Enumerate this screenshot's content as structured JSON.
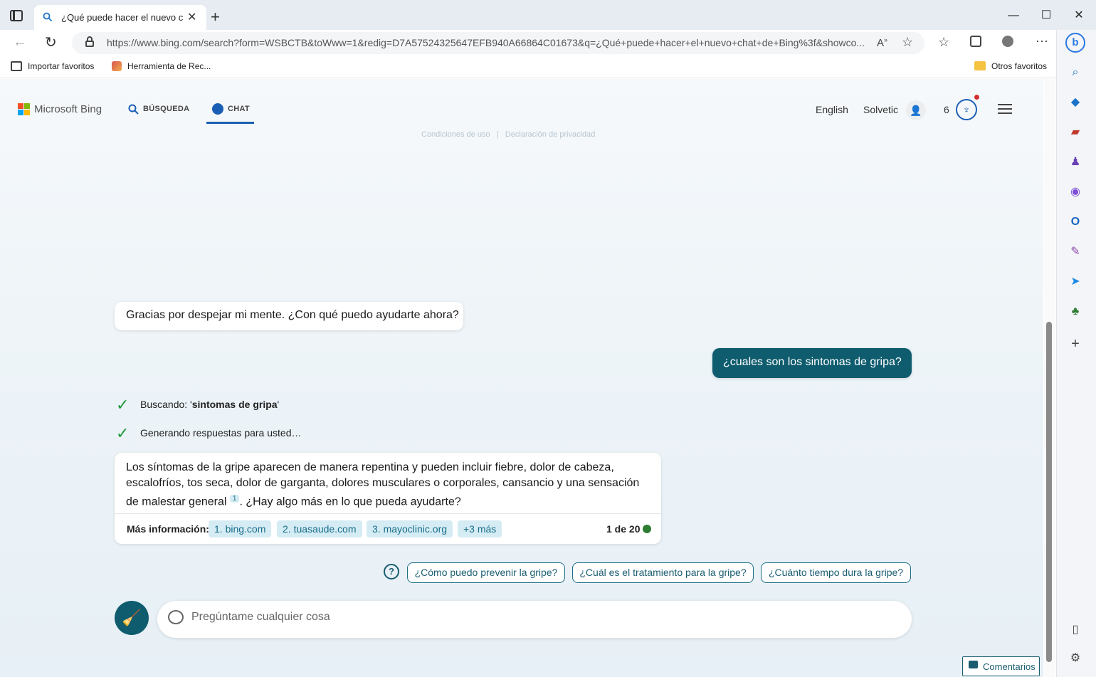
{
  "browser": {
    "tab_title": "¿Qué puede hacer el nuevo chat",
    "url": "https://www.bing.com/search?form=WSBCTB&toWww=1&redig=D7A57524325647EFB940A66864C01673&q=¿Qué+puede+hacer+el+nuevo+chat+de+Bing%3f&showco...",
    "favorites": [
      "Importar favoritos",
      "Herramienta de Rec..."
    ],
    "other_favorites": "Otros favoritos"
  },
  "header": {
    "logo": "Microsoft Bing",
    "nav_search": "BÚSQUEDA",
    "nav_chat": "CHAT",
    "language": "English",
    "user": "Solvetic",
    "points": "6",
    "faded_links": "Condiciones de uso   |   Declaración de privacidad"
  },
  "chat": {
    "bot_greeting": "Gracias por despejar mi mente. ¿Con qué puedo ayudarte ahora?",
    "user_message": "¿cuales son los sintomas de gripa?",
    "status_searching_prefix": "Buscando: '",
    "status_searching_term": "sintomas de gripa",
    "status_searching_suffix": "'",
    "status_generating": "Generando respuestas para usted…",
    "answer_part1": "Los síntomas de la gripe aparecen de manera repentina y pueden incluir fiebre, dolor de cabeza, escalofríos, tos seca, dolor de garganta, dolores musculares o corporales, cansancio y una sensación de malestar general",
    "answer_citation": "1",
    "answer_part2": ". ¿Hay algo más en lo que pueda ayudarte?",
    "more_info_label": "Más información:",
    "sources": [
      "1. bing.com",
      "2. tuasaude.com",
      "3. mayoclinic.org",
      "+3 más"
    ],
    "turn_counter": "1 de 20",
    "suggestions": [
      "¿Cómo puedo prevenir la gripe?",
      "¿Cuál es el tratamiento para la gripe?",
      "¿Cuánto tiempo dura la gripe?"
    ],
    "input_placeholder": "Pregúntame cualquier cosa"
  },
  "feedback": "Comentarios",
  "colors": {
    "accent_teal": "#0e5c6e",
    "check_green": "#1e9a3c",
    "chip_bg": "#d5ecf4"
  }
}
